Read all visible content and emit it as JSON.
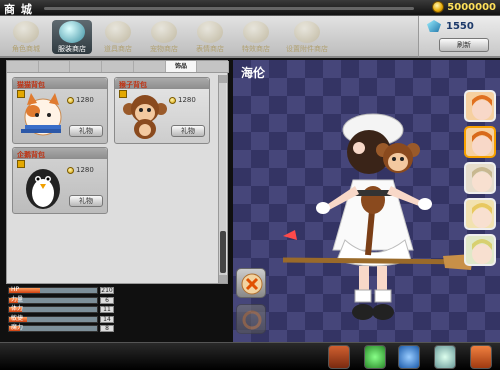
{
  "header": {
    "title": "商 城",
    "coins": "5000000"
  },
  "tabs": [
    {
      "label": "角色商城"
    },
    {
      "label": "服装商店",
      "active": true
    },
    {
      "label": "道具商店"
    },
    {
      "label": "宠物商店"
    },
    {
      "label": "表情商店"
    },
    {
      "label": "特效商店"
    },
    {
      "label": "设置附件商店"
    }
  ],
  "gems": {
    "value": "1550",
    "refresh_label": "刷新"
  },
  "category_tabs": [
    {
      "label": ""
    },
    {
      "label": ""
    },
    {
      "label": ""
    },
    {
      "label": ""
    },
    {
      "label": ""
    },
    {
      "label": "饰品",
      "active": true
    },
    {
      "label": ""
    }
  ],
  "items": [
    {
      "name": "猫猫背包",
      "price": "1280",
      "gift_label": "礼物",
      "icon": "cat-backpack-icon"
    },
    {
      "name": "猴子背包",
      "price": "1280",
      "gift_label": "礼物",
      "icon": "monkey-backpack-icon"
    },
    {
      "name": "企鹅背包",
      "price": "1280",
      "gift_label": "礼物",
      "icon": "penguin-backpack-icon"
    }
  ],
  "stats": [
    {
      "label": "HP",
      "value": "210",
      "fill": 0.35
    },
    {
      "label": "力量",
      "value": "6",
      "fill": 0.1
    },
    {
      "label": "体力",
      "value": "11",
      "fill": 0.15
    },
    {
      "label": "敏捷",
      "value": "14",
      "fill": 0.2
    },
    {
      "label": "魔力",
      "value": "8",
      "fill": 0.12
    }
  ],
  "stage": {
    "character_name": "海伦"
  },
  "colors": {
    "accent": "#f6a000",
    "stage_bg": "#343464",
    "coin": "#ffe15a"
  },
  "bottom_icons": [
    "chest-icon",
    "potion-icon",
    "orb-icon",
    "gear-gem-icon",
    "book-icon"
  ]
}
